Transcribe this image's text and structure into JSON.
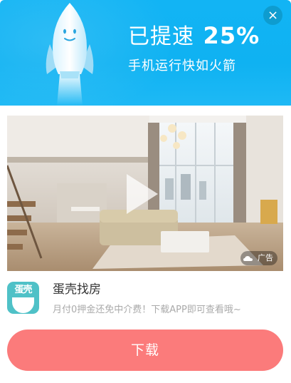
{
  "header": {
    "headline_prefix": "已提速",
    "headline_value": "25%",
    "subline": "手机运行快如火箭",
    "close_label": "×",
    "background_color": "#12b4f4",
    "rocket_icon": "rocket-icon"
  },
  "ad": {
    "image_description_icon": "video-thumbnail",
    "play_icon": "play-icon",
    "badge_label": "广告",
    "badge_logo_icon": "cloud-logo-icon"
  },
  "app": {
    "icon_text": "蛋壳",
    "name": "蛋壳找房",
    "description": "月付0押金还免中介费！下载APP即可查看哦~",
    "icon_color": "#4fc1c7"
  },
  "cta": {
    "label": "下载",
    "color": "#fb7b7b"
  }
}
